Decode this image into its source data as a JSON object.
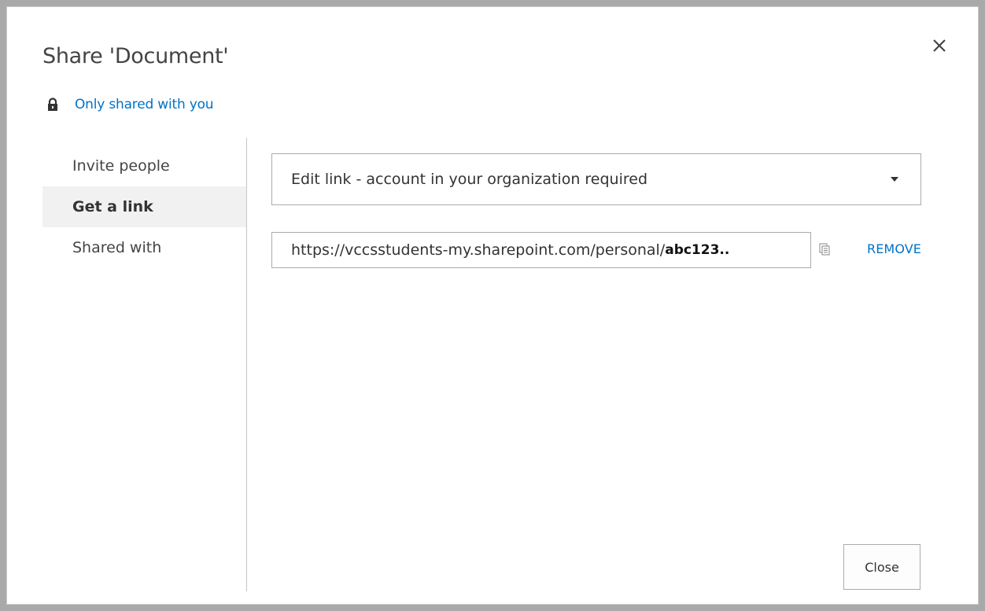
{
  "dialog": {
    "title": "Share 'Document'",
    "close_icon": "close-icon"
  },
  "share_status": {
    "icon": "lock-icon",
    "text": "Only shared with you"
  },
  "nav": {
    "items": [
      {
        "label": "Invite people",
        "selected": false
      },
      {
        "label": "Get a link",
        "selected": true
      },
      {
        "label": "Shared with",
        "selected": false
      }
    ]
  },
  "link_panel": {
    "link_type": {
      "selected": "Edit link - account in your organization required",
      "icon": "caret-down-icon"
    },
    "link_url": {
      "prefix": "https://vccsstudents-my.sharepoint.com/personal/",
      "suffix": "abc123.."
    },
    "copy_icon": "copy-icon",
    "remove_label": "REMOVE"
  },
  "footer": {
    "close_label": "Close"
  },
  "colors": {
    "accent": "#0072c6",
    "text": "#444444",
    "selected_bg": "#f1f1f1",
    "border": "#ababab"
  }
}
